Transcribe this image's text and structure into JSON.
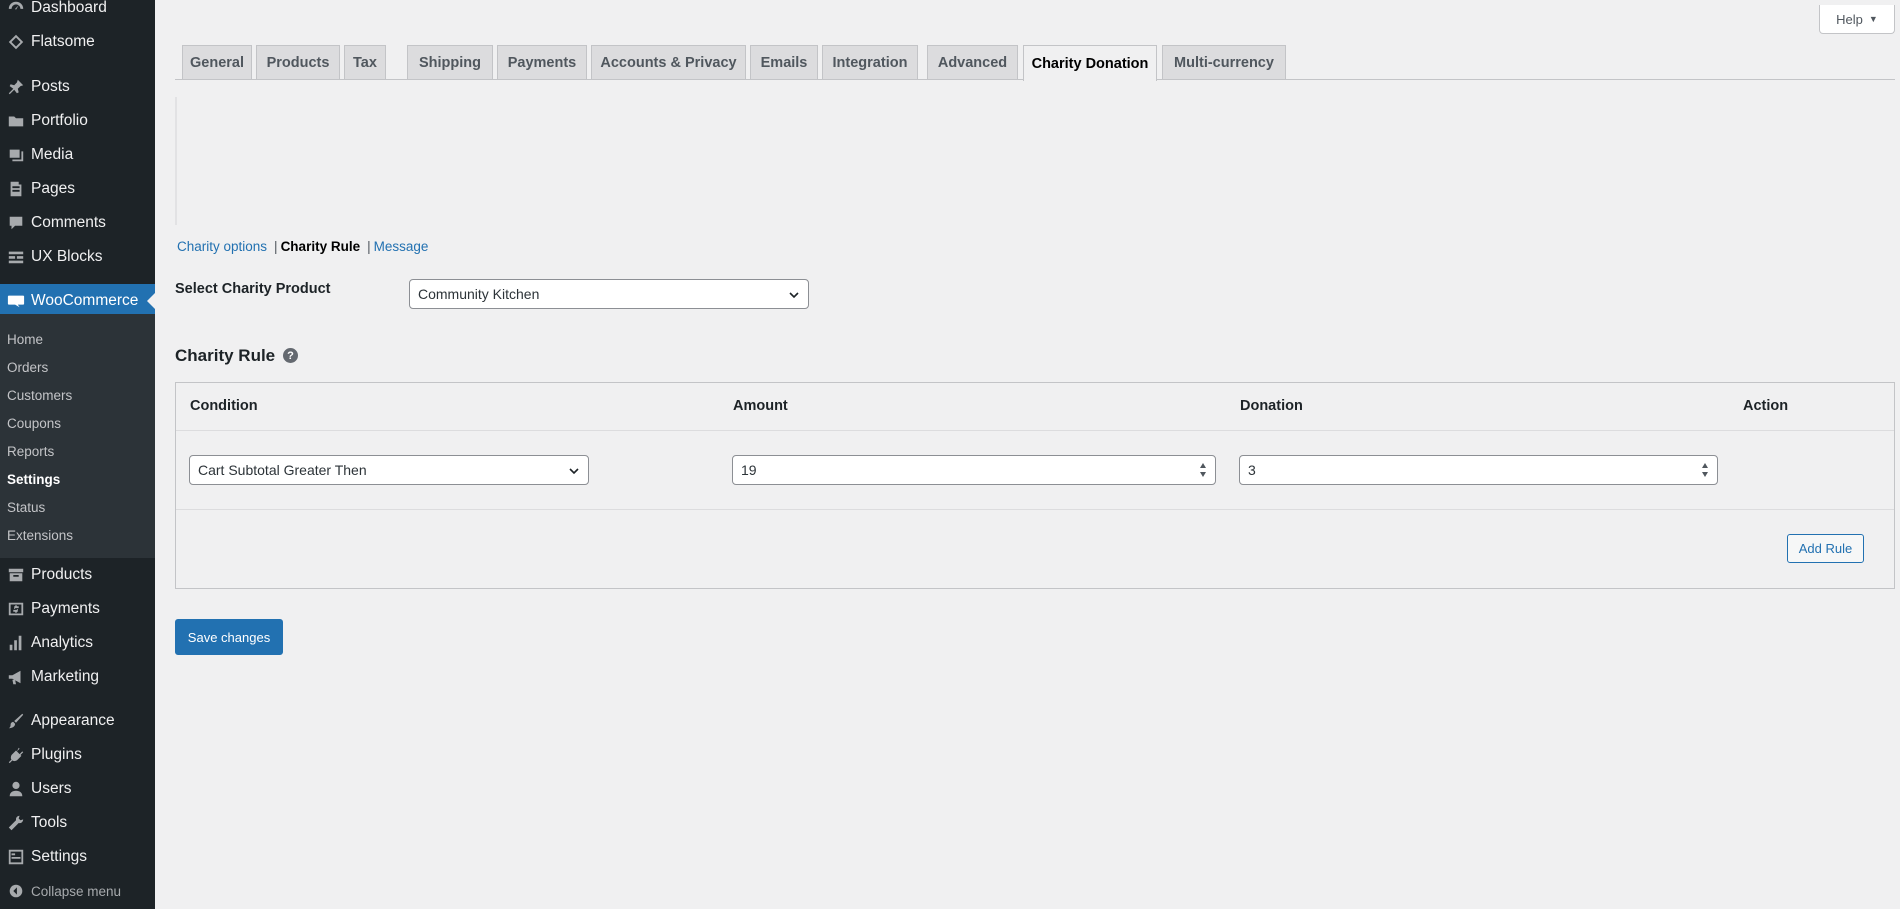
{
  "sidebar": {
    "items": [
      {
        "label": "Dashboard",
        "icon": "dashboard-icon"
      },
      {
        "label": "Flatsome",
        "icon": "flatsome-diamond-icon"
      },
      {
        "label": "Posts",
        "icon": "pin-icon"
      },
      {
        "label": "Portfolio",
        "icon": "folder-icon"
      },
      {
        "label": "Media",
        "icon": "media-icon"
      },
      {
        "label": "Pages",
        "icon": "page-icon"
      },
      {
        "label": "Comments",
        "icon": "comment-icon"
      },
      {
        "label": "UX Blocks",
        "icon": "blocks-icon"
      },
      {
        "label": "WooCommerce",
        "icon": "woo-icon"
      },
      {
        "label": "Products",
        "icon": "archive-icon"
      },
      {
        "label": "Payments",
        "icon": "dollar-icon"
      },
      {
        "label": "Analytics",
        "icon": "bar-chart-icon"
      },
      {
        "label": "Marketing",
        "icon": "megaphone-icon"
      },
      {
        "label": "Appearance",
        "icon": "brush-icon"
      },
      {
        "label": "Plugins",
        "icon": "plugin-icon"
      },
      {
        "label": "Users",
        "icon": "user-icon"
      },
      {
        "label": "Tools",
        "icon": "wrench-icon"
      },
      {
        "label": "Settings",
        "icon": "settings-icon"
      }
    ],
    "submenu": [
      "Home",
      "Orders",
      "Customers",
      "Coupons",
      "Reports",
      "Settings",
      "Status",
      "Extensions"
    ],
    "collapse_label": "Collapse menu"
  },
  "help_label": "Help",
  "tabs": [
    {
      "label": "General"
    },
    {
      "label": "Products"
    },
    {
      "label": "Tax"
    },
    {
      "label": "Shipping"
    },
    {
      "label": "Payments"
    },
    {
      "label": "Accounts & Privacy"
    },
    {
      "label": "Emails"
    },
    {
      "label": "Integration"
    },
    {
      "label": "Advanced"
    },
    {
      "label": "Charity Donation"
    },
    {
      "label": "Multi-currency"
    }
  ],
  "subnav": {
    "link1": "Charity options",
    "current": "Charity Rule",
    "link2": "Message",
    "separator": "|"
  },
  "form": {
    "product_label": "Select Charity Product",
    "product_value": "Community Kitchen"
  },
  "rule_section": {
    "title": "Charity Rule",
    "help_glyph": "?",
    "headers": {
      "condition": "Condition",
      "amount": "Amount",
      "donation": "Donation",
      "action": "Action"
    },
    "rows": [
      {
        "condition": "Cart Subtotal Greater Then",
        "amount": "19",
        "donation": "3"
      }
    ],
    "add_rule_label": "Add Rule"
  },
  "save_label": "Save changes",
  "colors": {
    "accent": "#2271b1",
    "sidebar_bg": "#1d2327",
    "page_bg": "#f0f0f1"
  }
}
